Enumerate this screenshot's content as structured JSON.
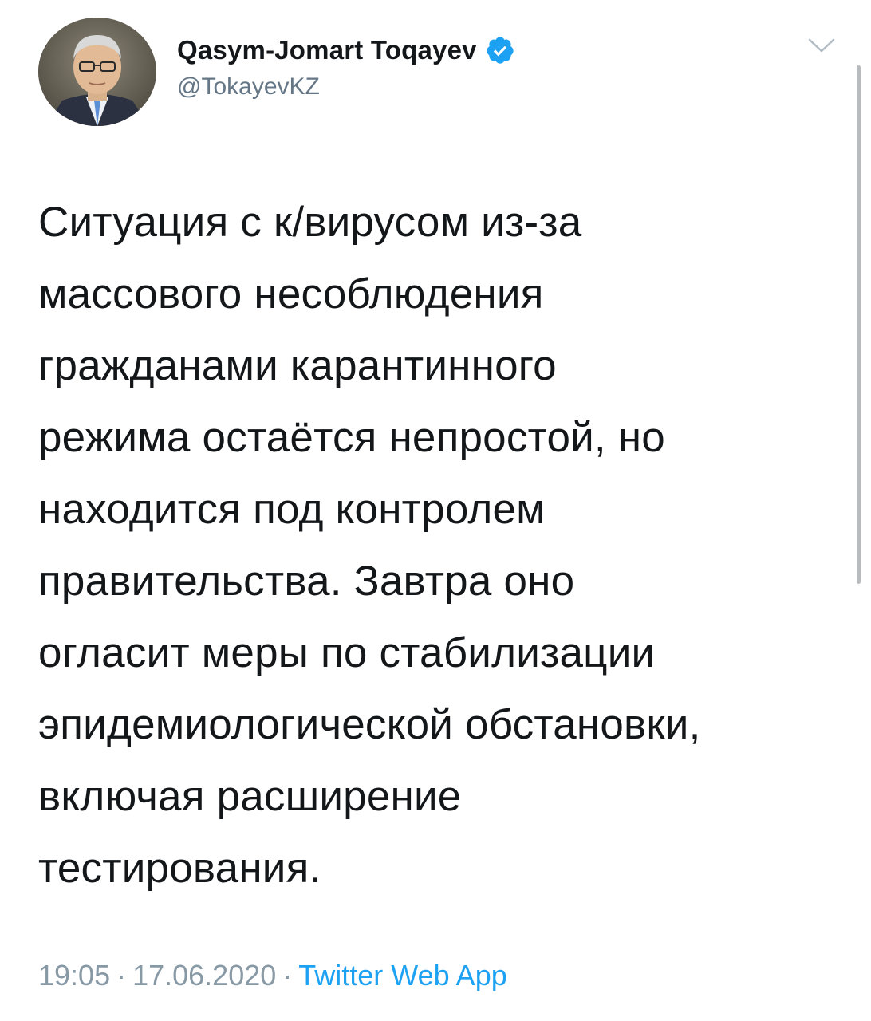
{
  "author": {
    "display_name": "Qasym-Jomart Toqayev",
    "handle": "@TokayevKZ",
    "verified": true,
    "verified_icon": "verified-badge-icon"
  },
  "tweet": {
    "text": "Ситуация с к/вирусом из-за\nмассового несоблюдения\nгражданами карантинного\nрежима остаётся непростой, но\nнаходится под контролем\nправительства. Завтра оно\nогласит меры по стабилизации\nэпидемиологической обстановки,\nвключая расширение\nтестирования."
  },
  "meta": {
    "time": "19:05",
    "separator": "·",
    "date": "17.06.2020",
    "source": "Twitter Web App"
  },
  "colors": {
    "text": "#14171a",
    "secondary": "#657786",
    "meta": "#8899a6",
    "link": "#1da1f2"
  },
  "icons": {
    "menu": "chevron-down-icon"
  }
}
